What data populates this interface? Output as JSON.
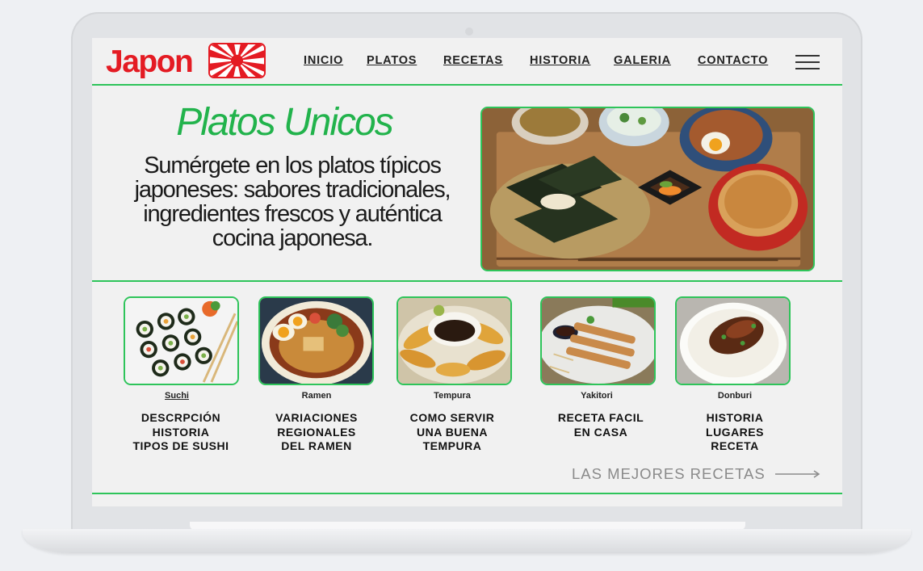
{
  "brand": {
    "name": "Japon",
    "color": "#e41b23",
    "flag_icon": "rising-sun-flag-icon"
  },
  "nav": {
    "items": [
      {
        "label": "INICIO"
      },
      {
        "label": "PLATOS"
      },
      {
        "label": "RECETAS"
      },
      {
        "label": "HISTORIA"
      },
      {
        "label": "GALERIA"
      },
      {
        "label": "CONTACTO"
      }
    ],
    "menu_icon": "hamburger-menu-icon"
  },
  "hero": {
    "title": "Platos Unicos",
    "text": "Sumérgete en los platos típicos japoneses: sabores tradicionales, ingredientes frescos y auténtica cocina japonesa.",
    "image": "japanese-set-meal-photo"
  },
  "cards": [
    {
      "name": "Suchi",
      "description": "DESCRPCIÓN\nHISTORIA\nTIPOS DE SUSHI",
      "image": "sushi-rolls-photo"
    },
    {
      "name": "Ramen",
      "description": "VARIACIONES\nREGIONALES\nDEL RAMEN",
      "image": "ramen-bowl-photo"
    },
    {
      "name": "Tempura",
      "description": "COMO SERVIR\nUNA BUENA\nTEMPURA",
      "image": "tempura-platter-photo"
    },
    {
      "name": "Yakitori",
      "description": "RECETA FACIL\nEN CASA",
      "image": "yakitori-skewers-photo"
    },
    {
      "name": "Donburi",
      "description": "HISTORIA\nLUGARES\nRECETA",
      "image": "donburi-bowl-photo"
    }
  ],
  "footer_link": {
    "label": "LAS MEJORES RECETAS",
    "icon": "long-arrow-right-icon"
  },
  "colors": {
    "accent_green": "#2ec45a",
    "title_green": "#22b34c",
    "brand_red": "#e41b23",
    "background": "#f1f1f1"
  }
}
